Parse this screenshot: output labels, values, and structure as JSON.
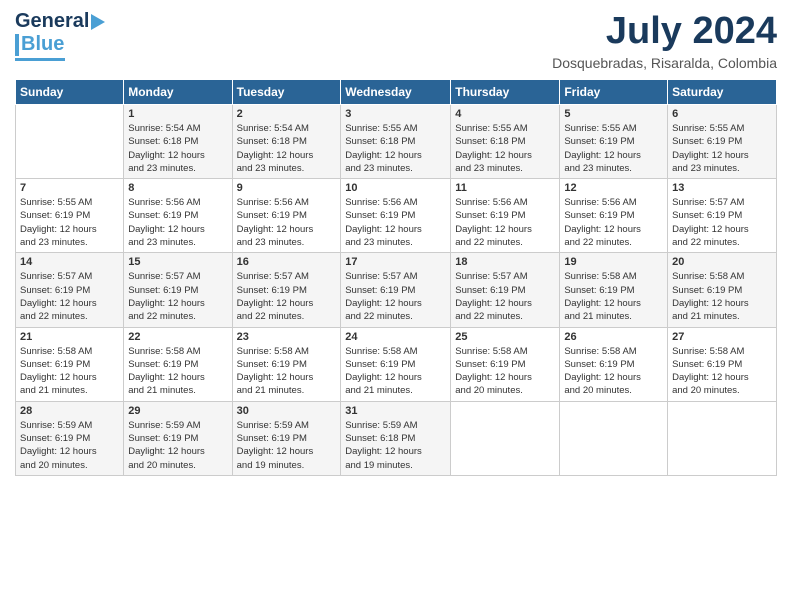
{
  "logo": {
    "line1": "General",
    "line2": "Blue"
  },
  "title": "July 2024",
  "subtitle": "Dosquebradas, Risaralda, Colombia",
  "days_header": [
    "Sunday",
    "Monday",
    "Tuesday",
    "Wednesday",
    "Thursday",
    "Friday",
    "Saturday"
  ],
  "weeks": [
    [
      {
        "day": "",
        "info": ""
      },
      {
        "day": "1",
        "info": "Sunrise: 5:54 AM\nSunset: 6:18 PM\nDaylight: 12 hours\nand 23 minutes."
      },
      {
        "day": "2",
        "info": "Sunrise: 5:54 AM\nSunset: 6:18 PM\nDaylight: 12 hours\nand 23 minutes."
      },
      {
        "day": "3",
        "info": "Sunrise: 5:55 AM\nSunset: 6:18 PM\nDaylight: 12 hours\nand 23 minutes."
      },
      {
        "day": "4",
        "info": "Sunrise: 5:55 AM\nSunset: 6:18 PM\nDaylight: 12 hours\nand 23 minutes."
      },
      {
        "day": "5",
        "info": "Sunrise: 5:55 AM\nSunset: 6:19 PM\nDaylight: 12 hours\nand 23 minutes."
      },
      {
        "day": "6",
        "info": "Sunrise: 5:55 AM\nSunset: 6:19 PM\nDaylight: 12 hours\nand 23 minutes."
      }
    ],
    [
      {
        "day": "7",
        "info": "Sunrise: 5:55 AM\nSunset: 6:19 PM\nDaylight: 12 hours\nand 23 minutes."
      },
      {
        "day": "8",
        "info": "Sunrise: 5:56 AM\nSunset: 6:19 PM\nDaylight: 12 hours\nand 23 minutes."
      },
      {
        "day": "9",
        "info": "Sunrise: 5:56 AM\nSunset: 6:19 PM\nDaylight: 12 hours\nand 23 minutes."
      },
      {
        "day": "10",
        "info": "Sunrise: 5:56 AM\nSunset: 6:19 PM\nDaylight: 12 hours\nand 23 minutes."
      },
      {
        "day": "11",
        "info": "Sunrise: 5:56 AM\nSunset: 6:19 PM\nDaylight: 12 hours\nand 22 minutes."
      },
      {
        "day": "12",
        "info": "Sunrise: 5:56 AM\nSunset: 6:19 PM\nDaylight: 12 hours\nand 22 minutes."
      },
      {
        "day": "13",
        "info": "Sunrise: 5:57 AM\nSunset: 6:19 PM\nDaylight: 12 hours\nand 22 minutes."
      }
    ],
    [
      {
        "day": "14",
        "info": "Sunrise: 5:57 AM\nSunset: 6:19 PM\nDaylight: 12 hours\nand 22 minutes."
      },
      {
        "day": "15",
        "info": "Sunrise: 5:57 AM\nSunset: 6:19 PM\nDaylight: 12 hours\nand 22 minutes."
      },
      {
        "day": "16",
        "info": "Sunrise: 5:57 AM\nSunset: 6:19 PM\nDaylight: 12 hours\nand 22 minutes."
      },
      {
        "day": "17",
        "info": "Sunrise: 5:57 AM\nSunset: 6:19 PM\nDaylight: 12 hours\nand 22 minutes."
      },
      {
        "day": "18",
        "info": "Sunrise: 5:57 AM\nSunset: 6:19 PM\nDaylight: 12 hours\nand 22 minutes."
      },
      {
        "day": "19",
        "info": "Sunrise: 5:58 AM\nSunset: 6:19 PM\nDaylight: 12 hours\nand 21 minutes."
      },
      {
        "day": "20",
        "info": "Sunrise: 5:58 AM\nSunset: 6:19 PM\nDaylight: 12 hours\nand 21 minutes."
      }
    ],
    [
      {
        "day": "21",
        "info": "Sunrise: 5:58 AM\nSunset: 6:19 PM\nDaylight: 12 hours\nand 21 minutes."
      },
      {
        "day": "22",
        "info": "Sunrise: 5:58 AM\nSunset: 6:19 PM\nDaylight: 12 hours\nand 21 minutes."
      },
      {
        "day": "23",
        "info": "Sunrise: 5:58 AM\nSunset: 6:19 PM\nDaylight: 12 hours\nand 21 minutes."
      },
      {
        "day": "24",
        "info": "Sunrise: 5:58 AM\nSunset: 6:19 PM\nDaylight: 12 hours\nand 21 minutes."
      },
      {
        "day": "25",
        "info": "Sunrise: 5:58 AM\nSunset: 6:19 PM\nDaylight: 12 hours\nand 20 minutes."
      },
      {
        "day": "26",
        "info": "Sunrise: 5:58 AM\nSunset: 6:19 PM\nDaylight: 12 hours\nand 20 minutes."
      },
      {
        "day": "27",
        "info": "Sunrise: 5:58 AM\nSunset: 6:19 PM\nDaylight: 12 hours\nand 20 minutes."
      }
    ],
    [
      {
        "day": "28",
        "info": "Sunrise: 5:59 AM\nSunset: 6:19 PM\nDaylight: 12 hours\nand 20 minutes."
      },
      {
        "day": "29",
        "info": "Sunrise: 5:59 AM\nSunset: 6:19 PM\nDaylight: 12 hours\nand 20 minutes."
      },
      {
        "day": "30",
        "info": "Sunrise: 5:59 AM\nSunset: 6:19 PM\nDaylight: 12 hours\nand 19 minutes."
      },
      {
        "day": "31",
        "info": "Sunrise: 5:59 AM\nSunset: 6:18 PM\nDaylight: 12 hours\nand 19 minutes."
      },
      {
        "day": "",
        "info": ""
      },
      {
        "day": "",
        "info": ""
      },
      {
        "day": "",
        "info": ""
      }
    ]
  ]
}
